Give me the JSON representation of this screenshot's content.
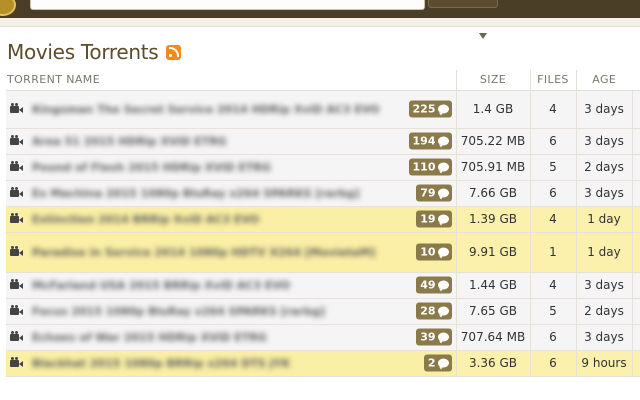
{
  "page": {
    "title": "Movies Torrents",
    "rss_icon": "rss-icon"
  },
  "colors": {
    "header_bar": "#4b3e26",
    "title_text": "#5d4c2b",
    "row_normal": "#f5f5f5",
    "row_highlight": "#fbf1ad",
    "comment_badge": "#8a7a4a",
    "rss": "#f08b1c"
  },
  "table": {
    "columns": {
      "name": "TORRENT NAME",
      "size": "SIZE",
      "files": "FILES",
      "age": "AGE"
    },
    "rows": [
      {
        "name": "Kingsman The Secret Service 2014 HDRip XviD AC3 EVO",
        "comments": "225",
        "size": "1.4 GB",
        "files": "4",
        "age": "3 days",
        "highlight": false
      },
      {
        "name": "Area 51 2015 HDRip XViD ETRG",
        "comments": "194",
        "size": "705.22 MB",
        "files": "6",
        "age": "3 days",
        "highlight": false
      },
      {
        "name": "Pound of Flesh 2015 HDRip XViD ETRG",
        "comments": "110",
        "size": "705.91 MB",
        "files": "5",
        "age": "2 days",
        "highlight": false
      },
      {
        "name": "Ex Machina 2015 1080p BluRay x264 SPARKS [rarbg]",
        "comments": "79",
        "size": "7.66 GB",
        "files": "6",
        "age": "3 days",
        "highlight": false
      },
      {
        "name": "Extinction 2014 BRRip XviD AC3 EVO",
        "comments": "19",
        "size": "1.39 GB",
        "files": "4",
        "age": "1 day",
        "highlight": true
      },
      {
        "name": "Paradise in Service 2014 1080p HDTV X264 [MovietaM]",
        "comments": "10",
        "size": "9.91 GB",
        "files": "1",
        "age": "1 day",
        "highlight": true
      },
      {
        "name": "McFarland USA 2015 BRRip XviD AC3 EVO",
        "comments": "49",
        "size": "1.44 GB",
        "files": "4",
        "age": "3 days",
        "highlight": false
      },
      {
        "name": "Focus 2015 1080p BluRay x264 SPARKS [rarbg]",
        "comments": "28",
        "size": "7.65 GB",
        "files": "5",
        "age": "2 days",
        "highlight": false
      },
      {
        "name": "Echoes of War 2015 HDRip XViD ETRG",
        "comments": "39",
        "size": "707.64 MB",
        "files": "6",
        "age": "3 days",
        "highlight": false
      },
      {
        "name": "Blackhat 2015 1080p BRRip x264 DTS JYK",
        "comments": "2",
        "size": "3.36 GB",
        "files": "6",
        "age": "9 hours",
        "highlight": true
      }
    ]
  }
}
